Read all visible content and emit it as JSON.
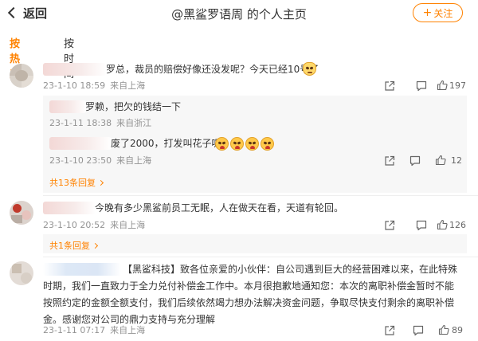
{
  "header": {
    "back_label": "返回",
    "title": "@黑鲨罗语周 的个人主页",
    "follow_label": "关注",
    "follow_plus": "+"
  },
  "tabs": [
    {
      "label": "按热度",
      "active": true
    },
    {
      "label": "按时间",
      "active": false
    }
  ],
  "comments": [
    {
      "text": "罗总，裁员的赔偿好像还没发呢？今天已经10号了",
      "time": "23-1-10 18:59",
      "location": "来自上海",
      "likes": "197",
      "replies": [
        {
          "text": "罗赖，把欠的钱结一下",
          "time": "23-1-11 18:38",
          "location": "来自浙江"
        },
        {
          "text": "废了2000，打发叫花子呢",
          "time": "23-1-10 23:50",
          "location": "来自上海",
          "likes": "12"
        }
      ],
      "more_replies": "共13条回复"
    },
    {
      "text": "今晚有多少黑鲨前员工无眠，人在做天在看，天道有轮回。",
      "time": "23-1-10 20:52",
      "location": "来自上海",
      "likes": "126",
      "more_replies": "共1条回复"
    },
    {
      "text": "【黑鲨科技】致各位亲爱的小伙伴：自公司遇到巨大的经营困难以来，在此特殊时期，我们一直致力于全力兑付补偿金工作中。本月很抱歉地通知您：本次的离职补偿金暂时不能按照约定的金额全额支付，我们后续依然竭力想办法解决资金问题，争取尽快支付剩余的离职补偿金。感谢您对公司的鼎力支持与充分理解",
      "time": "23-1-11 07:17",
      "location": "来自上海",
      "likes": "89"
    }
  ],
  "colors": {
    "accent": "#ff8200",
    "meta": "#939393",
    "reply_bg": "#f7f7f7"
  },
  "icons": [
    "share-icon",
    "comment-icon",
    "like-icon",
    "cat-emoji",
    "angry-emoji"
  ]
}
